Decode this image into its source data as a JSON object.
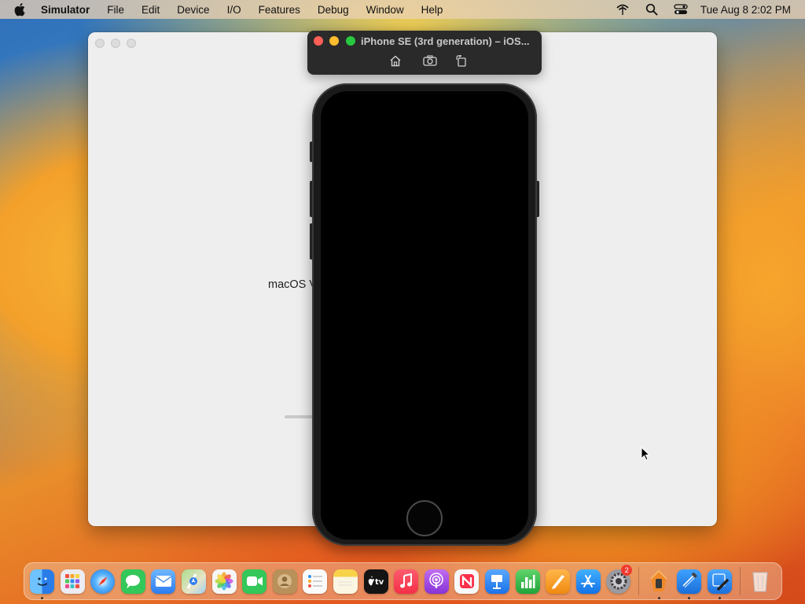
{
  "menubar": {
    "app_name": "Simulator",
    "items": [
      "File",
      "Edit",
      "Device",
      "I/O",
      "Features",
      "Debug",
      "Window",
      "Help"
    ],
    "clock": "Tue Aug 8  2:02 PM",
    "status_icons": [
      "wifi-disabled-icon",
      "search-icon",
      "control-center-icon"
    ]
  },
  "background_window": {
    "text": "macOS V",
    "loading_progress": 0.3
  },
  "simulator": {
    "title": "iPhone SE (3rd generation) – iOS...",
    "toolbar": [
      "home-icon",
      "screenshot-icon",
      "rotate-icon"
    ],
    "device_screen": "black"
  },
  "dock": {
    "apps": [
      {
        "name": "Finder",
        "icon": "finder-icon",
        "color": "#2a8af0",
        "running": true
      },
      {
        "name": "Launchpad",
        "icon": "launchpad-icon",
        "color": "#e8e8ee",
        "running": false
      },
      {
        "name": "Safari",
        "icon": "safari-icon",
        "color": "#1e88e5",
        "running": false
      },
      {
        "name": "Messages",
        "icon": "messages-icon",
        "color": "#34c759",
        "running": false
      },
      {
        "name": "Mail",
        "icon": "mail-icon",
        "color": "#3d8ff0",
        "running": false
      },
      {
        "name": "Maps",
        "icon": "maps-icon",
        "color": "#8fcf7a",
        "running": false
      },
      {
        "name": "Photos",
        "icon": "photos-icon",
        "color": "#f4f4f4",
        "running": false
      },
      {
        "name": "FaceTime",
        "icon": "facetime-icon",
        "color": "#34c759",
        "running": false
      },
      {
        "name": "Contacts",
        "icon": "contacts-icon",
        "color": "#b08a58",
        "running": false
      },
      {
        "name": "Reminders",
        "icon": "reminders-icon",
        "color": "#f6f6f6",
        "running": false
      },
      {
        "name": "Notes",
        "icon": "notes-icon",
        "color": "#f8d34a",
        "running": false
      },
      {
        "name": "TV",
        "icon": "tv-icon",
        "color": "#1a1a1a",
        "running": false
      },
      {
        "name": "Music",
        "icon": "music-icon",
        "color": "#fa3c52",
        "running": false
      },
      {
        "name": "Podcasts",
        "icon": "podcasts-icon",
        "color": "#9b4fe0",
        "running": false
      },
      {
        "name": "News",
        "icon": "news-icon",
        "color": "#f5f5f5",
        "running": false
      },
      {
        "name": "Keynote",
        "icon": "keynote-icon",
        "color": "#2f8ef0",
        "running": false
      },
      {
        "name": "Numbers",
        "icon": "numbers-icon",
        "color": "#34b34a",
        "running": false
      },
      {
        "name": "Pages",
        "icon": "pages-icon",
        "color": "#f39a1d",
        "running": false
      },
      {
        "name": "App Store",
        "icon": "app-store-icon",
        "color": "#1a8ff0",
        "running": false
      },
      {
        "name": "System Settings",
        "icon": "system-settings-icon",
        "color": "#8e8e93",
        "running": false,
        "badge": "2"
      }
    ],
    "apps_right": [
      {
        "name": "Simulator",
        "icon": "simulator-icon",
        "color": "#ef8a2a",
        "running": true
      },
      {
        "name": "Xcode",
        "icon": "xcode-icon",
        "color": "#1c7ce0",
        "running": true
      },
      {
        "name": "Xcode Tool",
        "icon": "xcode-tool-icon",
        "color": "#2b7fe0",
        "running": true
      }
    ],
    "trash": {
      "name": "Trash",
      "icon": "trash-icon"
    }
  },
  "cursor": "arrow-cursor-icon"
}
